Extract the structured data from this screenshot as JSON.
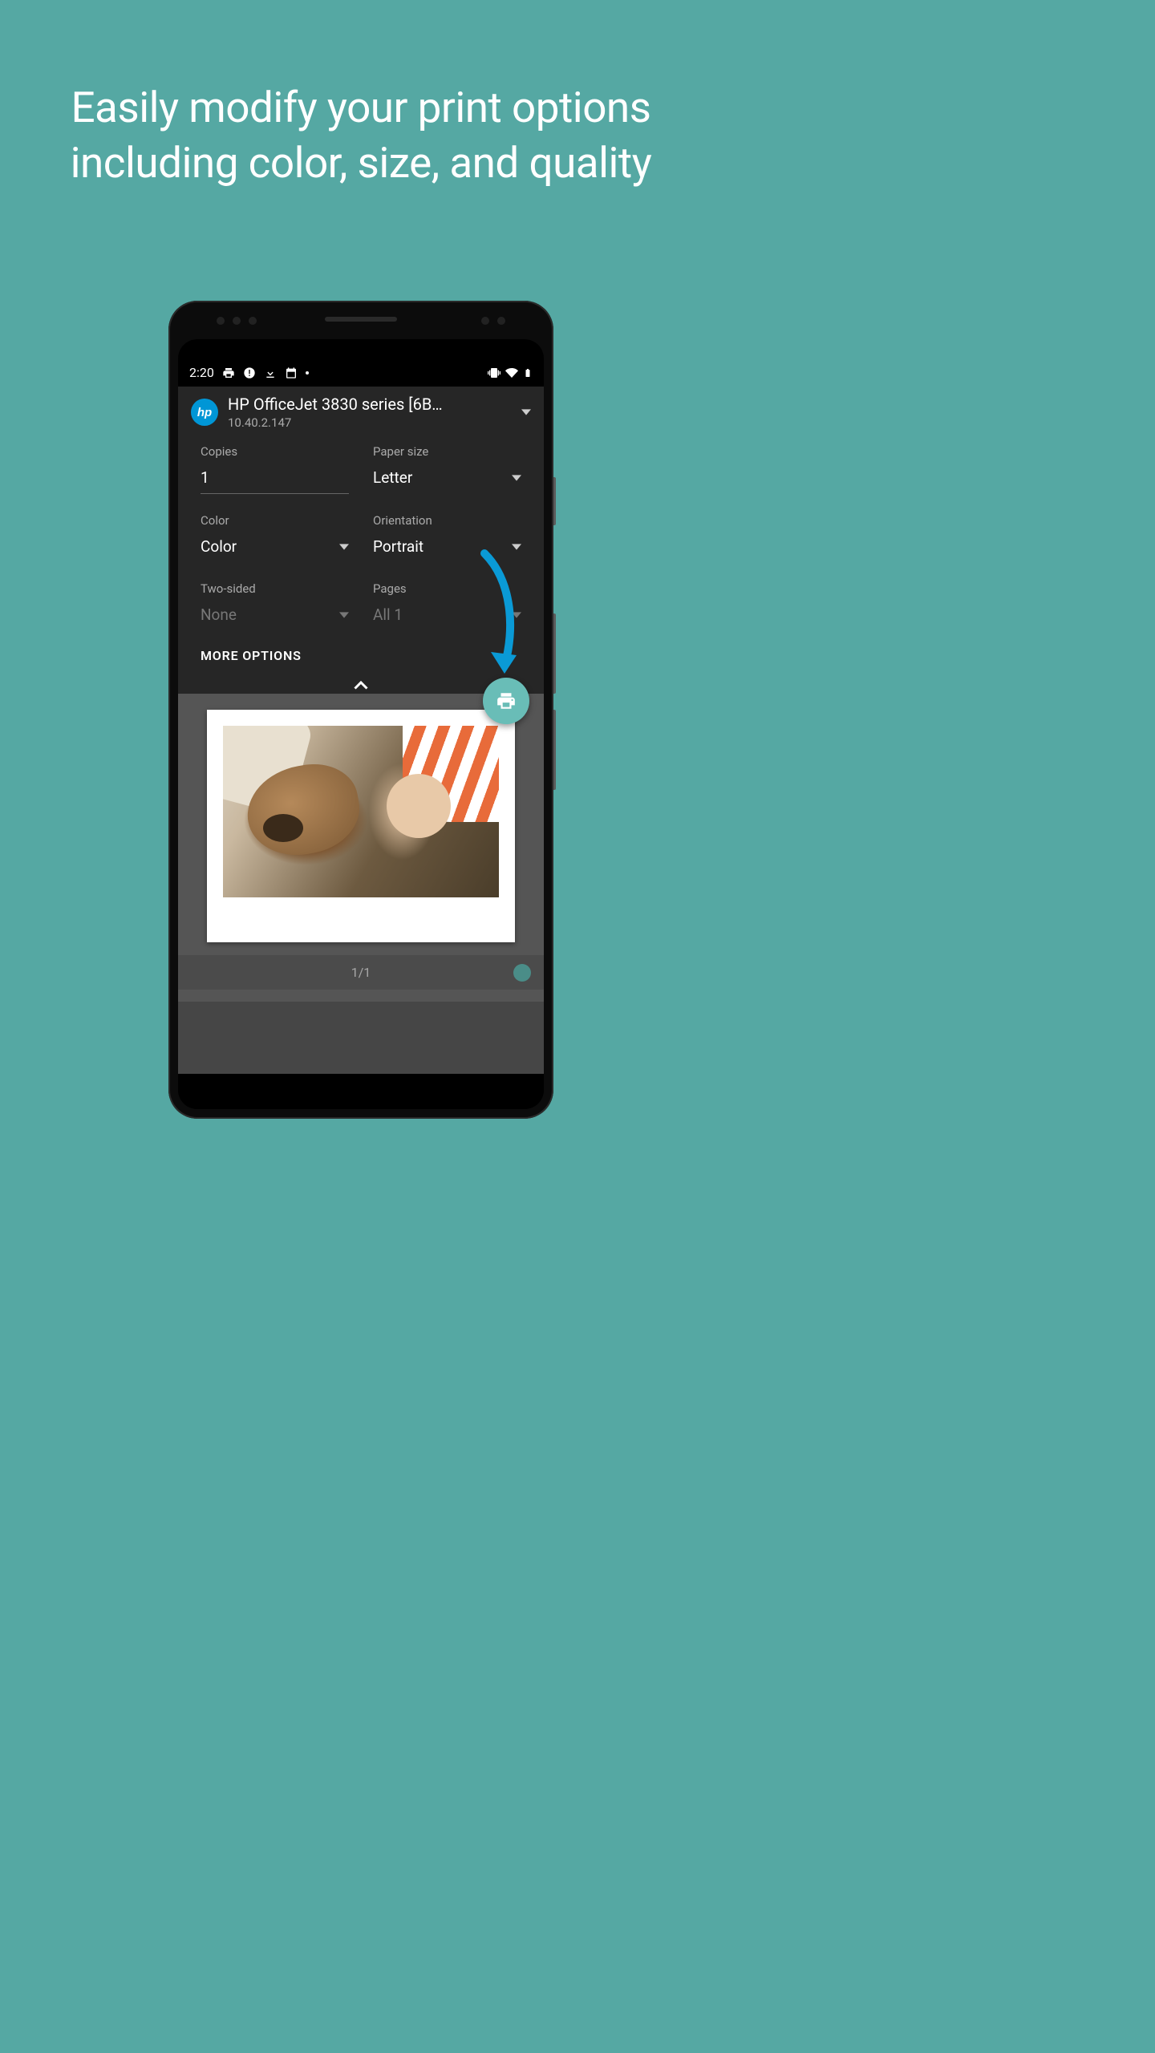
{
  "headline": "Easily modify your print options including color, size, and quality",
  "statusBar": {
    "time": "2:20"
  },
  "printer": {
    "logoText": "hp",
    "name": "HP OfficeJet 3830 series [6B…",
    "ip": "10.40.2.147"
  },
  "options": {
    "copies": {
      "label": "Copies",
      "value": "1"
    },
    "paperSize": {
      "label": "Paper size",
      "value": "Letter"
    },
    "color": {
      "label": "Color",
      "value": "Color"
    },
    "orientation": {
      "label": "Orientation",
      "value": "Portrait"
    },
    "twoSided": {
      "label": "Two-sided",
      "value": "None"
    },
    "pages": {
      "label": "Pages",
      "value": "All 1"
    }
  },
  "moreOptions": "MORE OPTIONS",
  "pageIndicator": "1/1"
}
